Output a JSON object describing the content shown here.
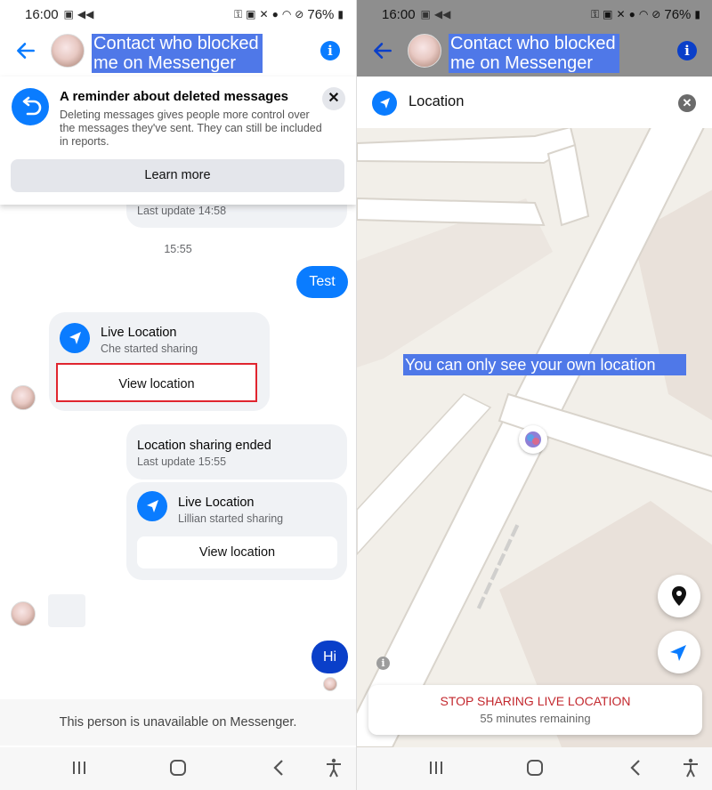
{
  "status_bar": {
    "time": "16:00",
    "battery": "76%"
  },
  "header": {
    "title": "Contact who blocked me on Messenger"
  },
  "reminder": {
    "title": "A reminder about deleted messages",
    "body": "Deleting messages gives people more control over the messages they've sent. They can still be included in reports.",
    "learn_more": "Learn more"
  },
  "chat": {
    "partial_last_update": "Last update 14:58",
    "timestamp": "15:55",
    "test_message": "Test",
    "live_location_1": {
      "title": "Live Location",
      "subtitle": "Che started sharing",
      "button": "View location"
    },
    "ended": {
      "title": "Location sharing ended",
      "subtitle": "Last update 15:55"
    },
    "live_location_2": {
      "title": "Live Location",
      "subtitle": "Lillian started sharing",
      "button": "View location"
    },
    "hi_message": "Hi"
  },
  "footer": {
    "unavailable": "This person is unavailable on Messenger."
  },
  "location_view": {
    "title": "Location",
    "note": "You can only see your own location",
    "stop_sharing": "STOP SHARING LIVE LOCATION",
    "remaining": "55 minutes remaining"
  },
  "colors": {
    "messenger_blue": "#0a7cff",
    "highlight": "#4f78e8",
    "stop_red": "#c3282e",
    "annotation_red": "#e0252f"
  },
  "icons": [
    "back-arrow-icon",
    "info-icon",
    "undo-icon",
    "close-icon",
    "navigation-arrow-icon",
    "map-pin-icon",
    "recent-apps-icon",
    "home-icon",
    "back-icon",
    "accessibility-icon"
  ]
}
